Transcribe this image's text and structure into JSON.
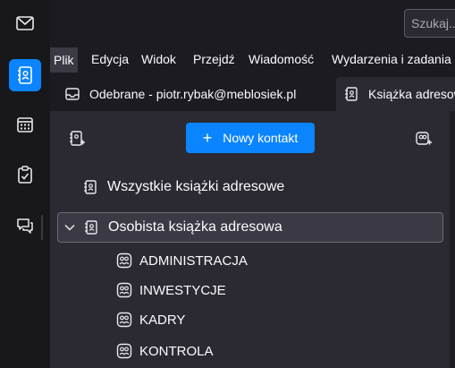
{
  "spaces_toolbar": {
    "items": [
      {
        "icon": "mail-icon",
        "active": false
      },
      {
        "icon": "address-book-icon",
        "active": true
      },
      {
        "icon": "calendar-icon",
        "active": false
      },
      {
        "icon": "tasks-icon",
        "active": false
      },
      {
        "icon": "chat-icon",
        "active": false
      }
    ],
    "accent": "#0a84ff"
  },
  "search": {
    "placeholder": "Szukaj..."
  },
  "menubar": {
    "items": [
      "Plik",
      "Edycja",
      "Widok",
      "Przejdź",
      "Wiadomość",
      "Wydarzenia i zadania"
    ]
  },
  "tabs": [
    {
      "label": "Odebrane - piotr.rybak@meblosiek.pl",
      "icon": "inbox-icon",
      "active": false
    },
    {
      "label": "Książka adresowa",
      "icon": "address-book-icon",
      "active": true
    }
  ],
  "toolbar": {
    "new_contact_label": "Nowy kontakt",
    "new_contact_icon": "plus-icon",
    "new_address_book_icon": "new-address-book-icon",
    "new_list_icon": "new-list-icon"
  },
  "address_books": {
    "all_label": "Wszystkie książki adresowe",
    "personal_label": "Osobista książka adresowa",
    "lists": [
      "ADMINISTRACJA",
      "INWESTYCJE",
      "KADRY",
      "KONTROLA"
    ]
  }
}
